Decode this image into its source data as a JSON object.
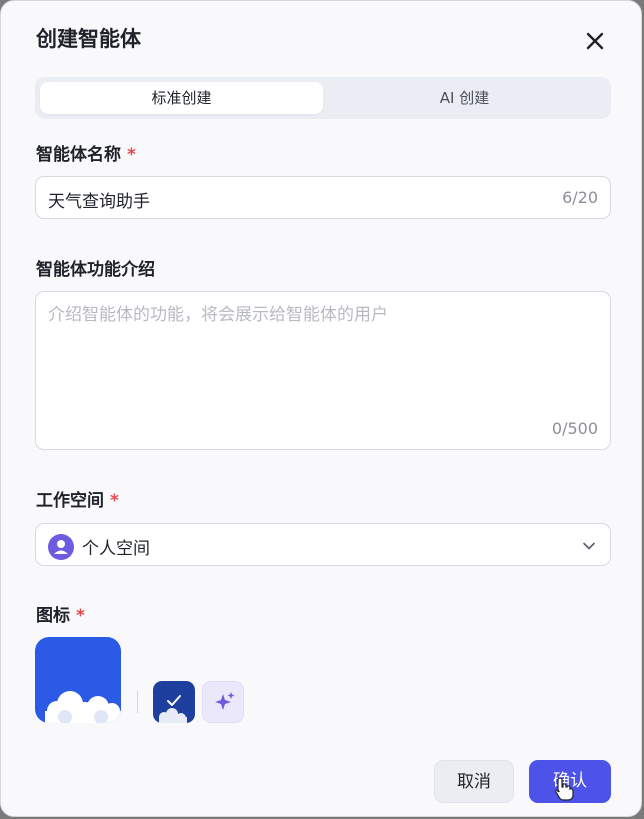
{
  "dialog": {
    "title": "创建智能体"
  },
  "tabs": [
    {
      "label": "标准创建",
      "active": true
    },
    {
      "label": "AI 创建",
      "active": false
    }
  ],
  "name_field": {
    "label": "智能体名称",
    "required_mark": "*",
    "value": "天气查询助手",
    "counter": "6/20"
  },
  "description_field": {
    "label": "智能体功能介绍",
    "placeholder": "介绍智能体的功能，将会展示给智能体的用户",
    "counter": "0/500"
  },
  "workspace_field": {
    "label": "工作空间",
    "required_mark": "*",
    "value": "个人空间"
  },
  "icon_field": {
    "label": "图标",
    "required_mark": "*"
  },
  "buttons": {
    "cancel": "取消",
    "confirm": "确认"
  },
  "colors": {
    "accent": "#4d53e8",
    "icon_blue": "#2b5be6",
    "required": "#e5484d",
    "workspace_badge": "#6e5ce0"
  },
  "icons": [
    "close-icon",
    "user-icon",
    "chevron-down-icon",
    "cloud-icon",
    "check-icon",
    "sparkle-icon",
    "hand-cursor-icon"
  ]
}
